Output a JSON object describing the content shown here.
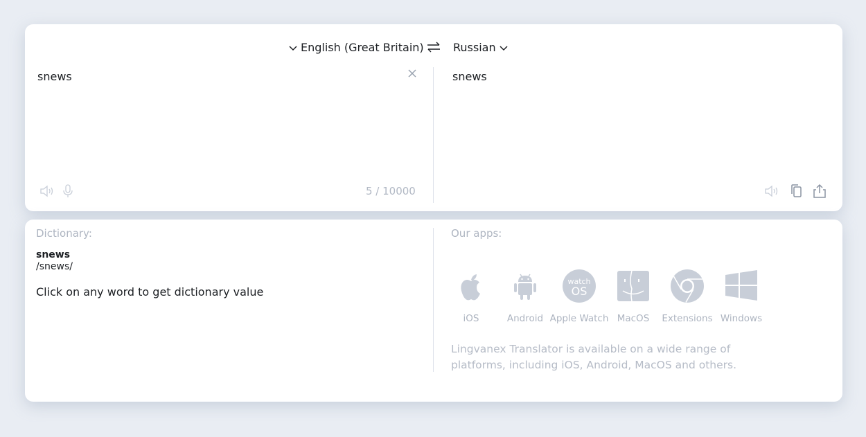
{
  "translator": {
    "source_language": "English (Great Britain)",
    "target_language": "Russian",
    "source_text": "snews",
    "target_text": "snews",
    "char_counter": "5 / 10000"
  },
  "icons": {
    "chevron": "chevron-down-icon",
    "swap": "swap-arrows-icon",
    "clear": "close-icon",
    "speaker": "speaker-icon",
    "mic": "microphone-icon",
    "copy": "copy-icon",
    "share": "share-icon"
  },
  "dictionary": {
    "label": "Dictionary:",
    "word": "snews",
    "transcription": "/snews/",
    "hint": "Click on any word to get dictionary value"
  },
  "apps": {
    "label": "Our apps:",
    "items": [
      {
        "label": "iOS",
        "icon": "apple-icon"
      },
      {
        "label": "Android",
        "icon": "android-icon"
      },
      {
        "label": "Apple Watch",
        "icon": "watchos-icon",
        "icon_text_top": "watch",
        "icon_text_bottom": "OS"
      },
      {
        "label": "MacOS",
        "icon": "finder-icon"
      },
      {
        "label": "Extensions",
        "icon": "chrome-icon"
      },
      {
        "label": "Windows",
        "icon": "windows-icon"
      }
    ],
    "description": "Lingvanex Translator is available on a wide range of platforms, including iOS, Android, MacOS and others."
  },
  "colors": {
    "background": "#e9edf3",
    "card": "#ffffff",
    "muted_icon": "#c8ced8",
    "muted_text": "#aeb5c1"
  }
}
